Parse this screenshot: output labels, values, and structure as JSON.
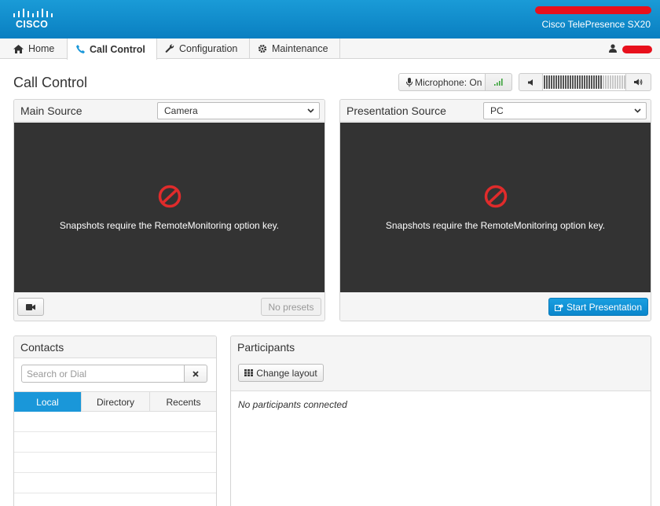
{
  "header": {
    "logo_text": "CISCO",
    "product": "Cisco TelePresence SX20",
    "brand_color": "#0a86cc"
  },
  "nav": {
    "tabs": [
      {
        "label": "Home",
        "icon": "home-icon"
      },
      {
        "label": "Call Control",
        "icon": "phone-icon",
        "active": true
      },
      {
        "label": "Configuration",
        "icon": "wrench-icon"
      },
      {
        "label": "Maintenance",
        "icon": "gear-icon"
      }
    ],
    "user_icon": "user-icon"
  },
  "page": {
    "title": "Call Control"
  },
  "microphone": {
    "label": "Microphone: On",
    "icon": "microphone-icon",
    "level_icon": "signal-bars-icon"
  },
  "volume": {
    "down_icon": "volume-down-icon",
    "up_icon": "volume-up-icon",
    "level_percent": 70
  },
  "main_source": {
    "title": "Main Source",
    "selected": "Camera",
    "message": "Snapshots require the RemoteMonitoring option key.",
    "camera_icon": "video-camera-icon",
    "presets_label": "No presets"
  },
  "presentation_source": {
    "title": "Presentation Source",
    "selected": "PC",
    "message": "Snapshots require the RemoteMonitoring option key.",
    "start_label": "Start Presentation",
    "start_icon": "share-icon"
  },
  "contacts": {
    "title": "Contacts",
    "search_placeholder": "Search or Dial",
    "clear_icon": "close-icon",
    "tabs": [
      {
        "label": "Local",
        "active": true
      },
      {
        "label": "Directory"
      },
      {
        "label": "Recents"
      }
    ]
  },
  "participants": {
    "title": "Participants",
    "layout_label": "Change layout",
    "layout_icon": "grid-icon",
    "empty_text": "No participants connected"
  }
}
